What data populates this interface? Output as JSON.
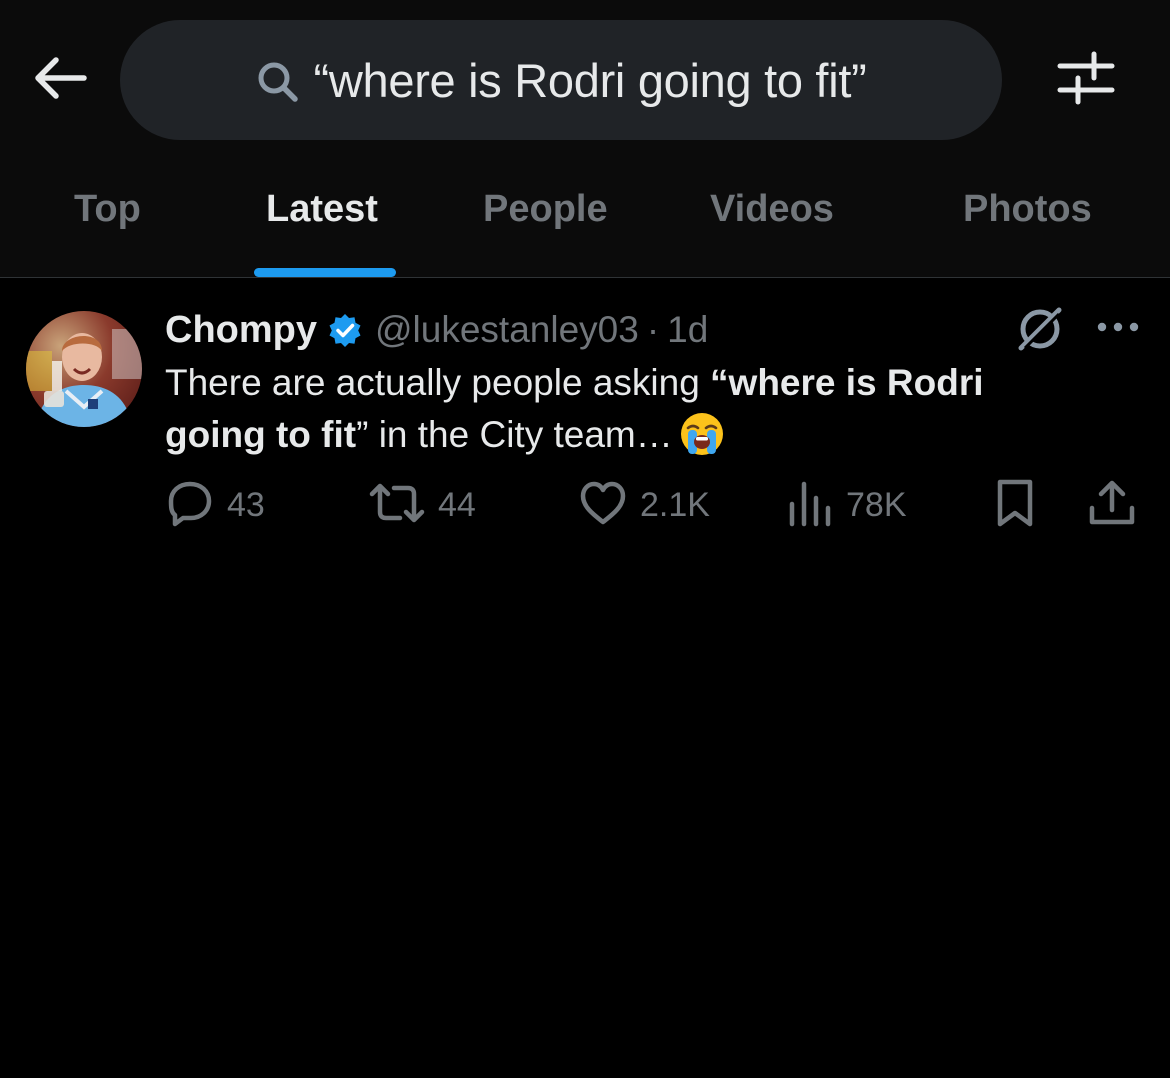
{
  "search": {
    "query": "“where is Rodri going to fit”"
  },
  "tabs": [
    {
      "label": "Top",
      "active": false
    },
    {
      "label": "Latest",
      "active": true
    },
    {
      "label": "People",
      "active": false
    },
    {
      "label": "Videos",
      "active": false
    },
    {
      "label": "Photos",
      "active": false
    }
  ],
  "tweet": {
    "display_name": "Chompy",
    "verified": true,
    "handle": "@lukestanley03",
    "separator": "·",
    "time": "1d",
    "text": {
      "part1": "There are actually people asking ",
      "bold": "“where is Rodri going to fit",
      "part2": "” in the City team…"
    },
    "emoji": "loudly-crying-face",
    "stats": {
      "replies": "43",
      "reposts": "44",
      "likes": "2.1K",
      "views": "78K"
    }
  },
  "colors": {
    "accent": "#1d9bf0",
    "muted": "#71767b",
    "text": "#e7e9ea",
    "background": "#000000"
  },
  "icons": [
    "back-arrow-icon",
    "search-icon",
    "filter-sliders-icon",
    "verified-badge-icon",
    "grok-icon",
    "more-icon",
    "reply-icon",
    "repost-icon",
    "like-icon",
    "views-icon",
    "bookmark-icon",
    "share-icon"
  ]
}
